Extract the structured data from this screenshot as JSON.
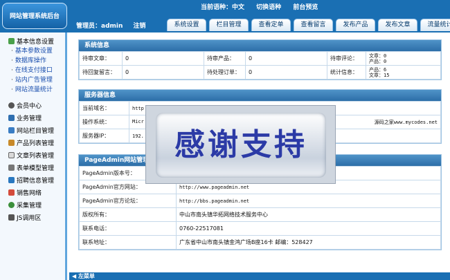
{
  "header": {
    "logo": "网站管理系统后台",
    "lang_label": "当前语种：中文",
    "switch_lang": "切换语种",
    "frontend_preview": "前台预览",
    "admin_label": "管理员：admin",
    "logout": "注销"
  },
  "tabs": [
    "系统设置",
    "栏目管理",
    "查看定单",
    "查看留言",
    "发布产品",
    "发布文章",
    "流量统计"
  ],
  "sidebar": {
    "head": "基本信息设置",
    "subitems": [
      "基本参数设置",
      "数据库操作",
      "在线支付接口",
      "站内广告管理",
      "网站流量统计"
    ],
    "items": [
      "会员中心",
      "业务管理",
      "网站栏目管理",
      "产品列表管理",
      "文章列表管理",
      "表单模型管理",
      "招聘信息管理",
      "销售网络",
      "采集管理",
      "JS调用区"
    ]
  },
  "system_info": {
    "title": "系统信息",
    "rows": [
      [
        "待审文章：",
        "0",
        "待审产品：",
        "0",
        "待审评论：",
        "文章：0",
        "产品：0"
      ],
      [
        "待回复留言：",
        "0",
        "待处理订单：",
        "0",
        "统计信息：",
        "产品：6",
        "文章：15"
      ]
    ]
  },
  "server_info": {
    "title": "服务器信息",
    "domain_label": "当前域名：",
    "domain_value": "http",
    "os_label": "操作系统：",
    "os_value": "Micr",
    "ip_label": "服务器IP：",
    "ip_value": "192.",
    "credit": "源码之家www.mycodes.net"
  },
  "pageadmin": {
    "title": "PageAdmin网站管理",
    "rows": [
      [
        "PageAdmin版本号：",
        ""
      ],
      [
        "PageAdmin官方网站：",
        "http://www.pageadmin.net"
      ],
      [
        "PageAdmin官方论坛：",
        "http://bbs.pageadmin.net"
      ],
      [
        "版权所有：",
        "中山市南头镇华拓网络技术服务中心"
      ],
      [
        "联系电话：",
        "0760-22517081"
      ],
      [
        "联系地址：",
        "广东省中山市南头镇金鸿广场B座16卡  邮编：528427"
      ]
    ]
  },
  "banner_text": "感谢支持",
  "bottom_label": "◀ 左菜单",
  "colors": {
    "header_bg": "#1a6fb3",
    "panel_title": "#2d6ea8",
    "banner_text": "#2b3aa6"
  }
}
